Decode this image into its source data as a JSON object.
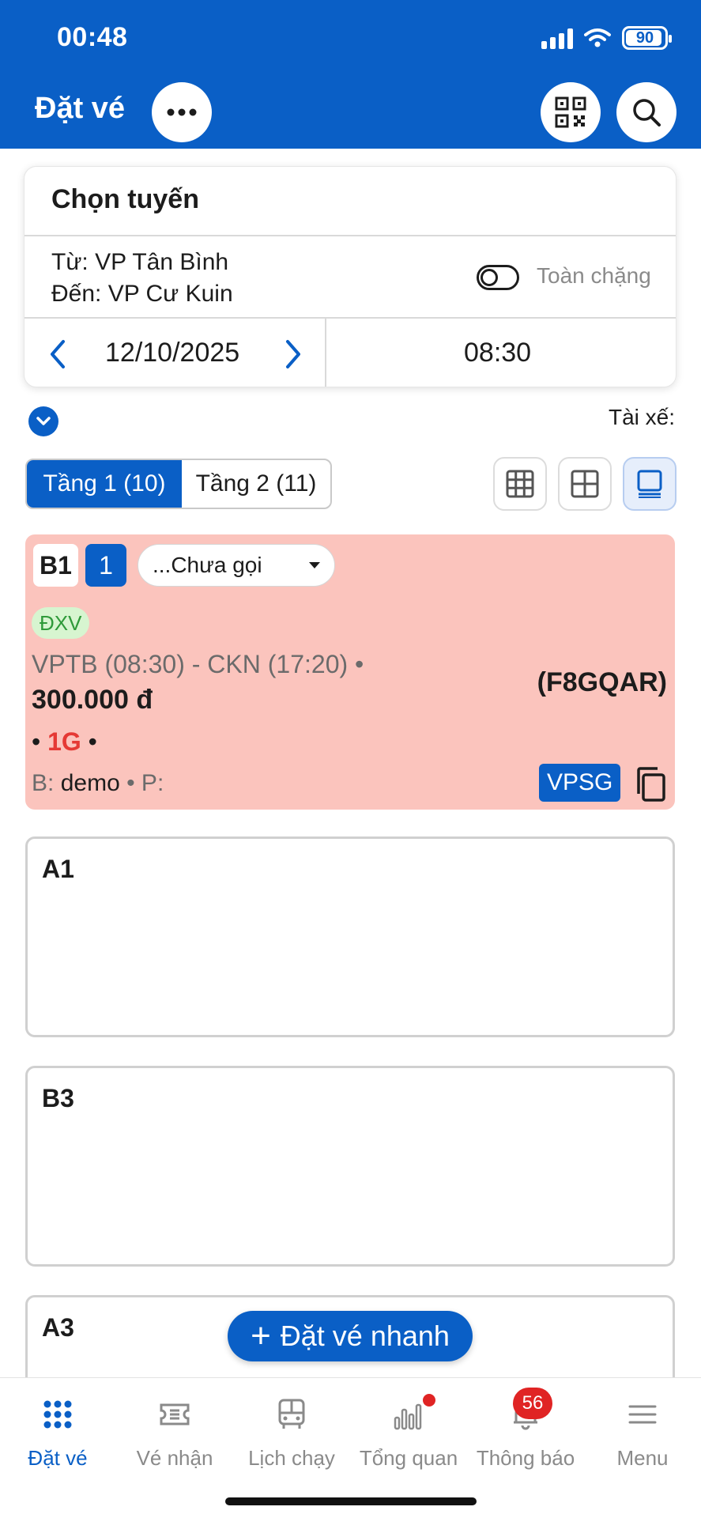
{
  "status_bar": {
    "time": "00:48",
    "battery": "90"
  },
  "header": {
    "title": "Đặt vé"
  },
  "route": {
    "section_title": "Chọn tuyến",
    "from": "Từ: VP Tân Bình",
    "to": "Đến: VP Cư Kuin",
    "toggle_label": "Toàn chặng",
    "date": "12/10/2025",
    "time": "08:30"
  },
  "driver_label": "Tài xế:",
  "floors": [
    {
      "label": "Tầng 1 (10)",
      "active": true
    },
    {
      "label": "Tầng 2 (11)",
      "active": false
    }
  ],
  "booked_seat": {
    "seat": "B1",
    "count": "1",
    "call_status": "...Chưa gọi",
    "tag": "ĐXV",
    "trip": "VPTB (08:30) - CKN (17:20) •",
    "price": "300.000 đ",
    "code": "(F8GQAR)",
    "goods_prefix": "•",
    "goods": "1G",
    "goods_suffix": "•",
    "bp_prefix": "B:",
    "bp_value": "demo",
    "bp_suffix": "• P:",
    "office": "VPSG"
  },
  "empty_seats": [
    "A1",
    "B3",
    "A3"
  ],
  "quick_book": {
    "plus": "+",
    "label": "Đặt vé nhanh"
  },
  "bottom_nav": [
    {
      "label": "Đặt vé",
      "icon": "grid-dots-icon",
      "active": true
    },
    {
      "label": "Vé nhận",
      "icon": "ticket-icon",
      "active": false
    },
    {
      "label": "Lịch chạy",
      "icon": "bus-icon",
      "active": false
    },
    {
      "label": "Tổng quan",
      "icon": "bar-chart-icon",
      "active": false
    },
    {
      "label": "Thông báo",
      "icon": "bell-icon",
      "active": false,
      "badge": "56"
    },
    {
      "label": "Menu",
      "icon": "menu-icon",
      "active": false
    }
  ],
  "colors": {
    "primary": "#0a5fc6",
    "booked": "#fbc4bd",
    "alert": "#e02424"
  }
}
